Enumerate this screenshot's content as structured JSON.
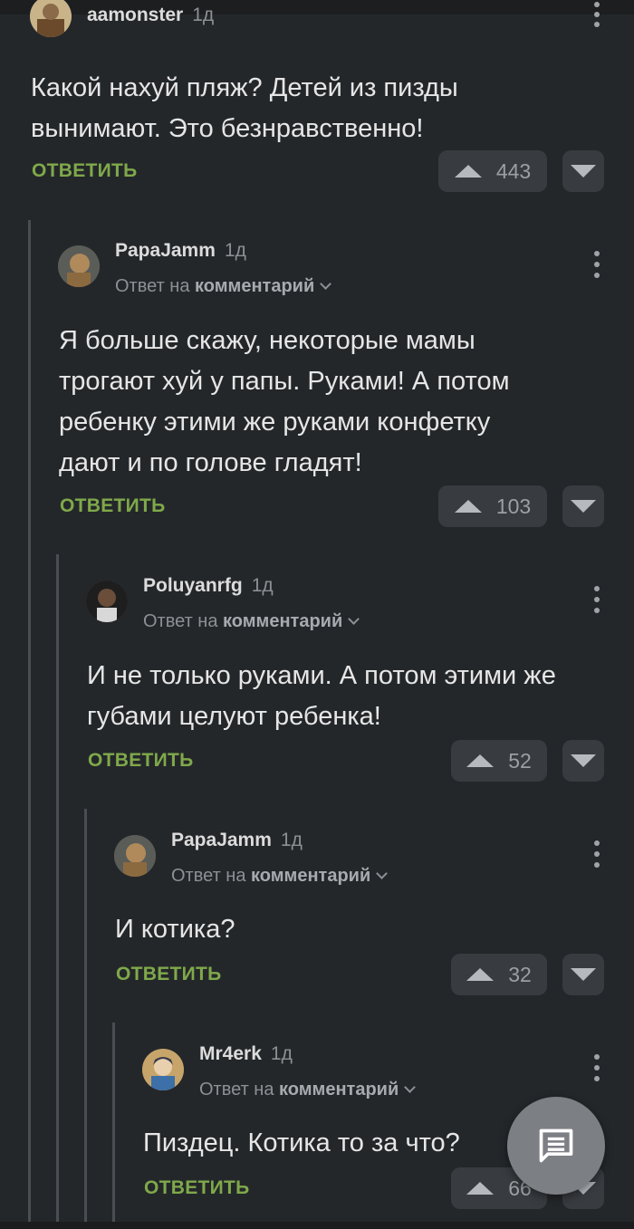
{
  "comments": [
    {
      "author": "aamonster",
      "time": "1д",
      "reply_prefix": "",
      "reply_target": "",
      "text_lines": [
        "Какой нахуй пляж? Детей из пизды",
        "вынимают. Это безнравственно!"
      ],
      "reply_label": "ОТВЕТИТЬ",
      "votes": "443",
      "avatar_icon": "user-avatar-aamonster"
    },
    {
      "author": "PapaJamm",
      "time": "1д",
      "reply_prefix": "Ответ на",
      "reply_target": "комментарий",
      "text_lines": [
        "Я больше скажу, некоторые мамы",
        "трогают хуй у папы. Руками! А потом",
        "ребенку этими же руками конфетку",
        "дают и по голове гладят!"
      ],
      "reply_label": "ОТВЕТИТЬ",
      "votes": "103",
      "avatar_icon": "user-avatar-papajamm"
    },
    {
      "author": "Poluyanrfg",
      "time": "1д",
      "reply_prefix": "Ответ на",
      "reply_target": "комментарий",
      "text_lines": [
        "И не только руками. А потом этими же",
        "губами целуют ребенка!"
      ],
      "reply_label": "ОТВЕТИТЬ",
      "votes": "52",
      "avatar_icon": "user-avatar-poluyanrfg"
    },
    {
      "author": "PapaJamm",
      "time": "1д",
      "reply_prefix": "Ответ на",
      "reply_target": "комментарий",
      "text_lines": [
        "И котика?"
      ],
      "reply_label": "ОТВЕТИТЬ",
      "votes": "32",
      "avatar_icon": "user-avatar-papajamm"
    },
    {
      "author": "Mr4erk",
      "time": "1д",
      "reply_prefix": "Ответ на",
      "reply_target": "комментарий",
      "text_lines": [
        "Пиздец. Котика то за что?"
      ],
      "reply_label": "ОТВЕТИТЬ",
      "votes": "66",
      "avatar_icon": "user-avatar-mr4erk"
    }
  ],
  "fab": {
    "icon": "comment-icon"
  },
  "colors": {
    "background": "#24272a",
    "reply_green": "#7fa94a",
    "vote_button": "#383b3f",
    "thread_line": "#4a4d51"
  }
}
